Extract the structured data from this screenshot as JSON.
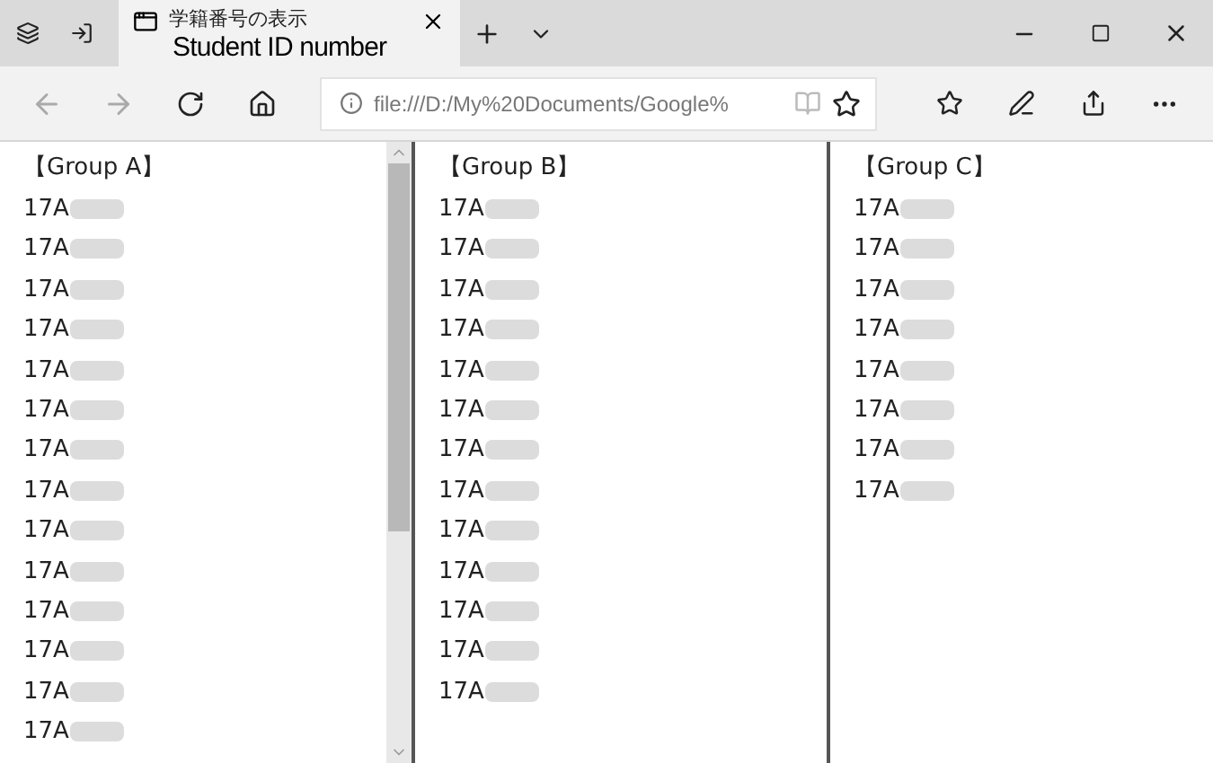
{
  "browser": {
    "tab": {
      "title": "学籍番号の表示",
      "selected": true
    },
    "annotation": "Student ID number",
    "address": "file:///D:/My%20Documents/Google%"
  },
  "frames": [
    {
      "heading": "【Group A】",
      "scrollable": true,
      "items": [
        {
          "text": "17A",
          "redacted": true
        },
        {
          "text": "17A",
          "redacted": true
        },
        {
          "text": "17A",
          "redacted": true
        },
        {
          "text": "17A",
          "redacted": true
        },
        {
          "text": "17A",
          "redacted": true
        },
        {
          "text": "17A",
          "redacted": true
        },
        {
          "text": "17A",
          "redacted": true
        },
        {
          "text": "17A",
          "redacted": true
        },
        {
          "text": "17A",
          "redacted": true
        },
        {
          "text": "17A",
          "redacted": true
        },
        {
          "text": "17A",
          "redacted": true
        },
        {
          "text": "17A",
          "redacted": true
        },
        {
          "text": "17A",
          "redacted": true
        },
        {
          "text": "17A",
          "redacted": true
        }
      ]
    },
    {
      "heading": "【Group B】",
      "scrollable": false,
      "items": [
        {
          "text": "17A",
          "redacted": true
        },
        {
          "text": "17A",
          "redacted": true
        },
        {
          "text": "17A",
          "redacted": true
        },
        {
          "text": "17A",
          "redacted": true
        },
        {
          "text": "17A",
          "redacted": true
        },
        {
          "text": "17A",
          "redacted": true
        },
        {
          "text": "17A",
          "redacted": true
        },
        {
          "text": "17A",
          "redacted": true
        },
        {
          "text": "17A",
          "redacted": true
        },
        {
          "text": "17A",
          "redacted": true
        },
        {
          "text": "17A",
          "redacted": true
        },
        {
          "text": "17A",
          "redacted": true
        },
        {
          "text": "17A",
          "redacted": true
        }
      ]
    },
    {
      "heading": "【Group C】",
      "scrollable": false,
      "items": [
        {
          "text": "17A",
          "redacted": true
        },
        {
          "text": "17A",
          "redacted": true
        },
        {
          "text": "17A",
          "redacted": true
        },
        {
          "text": "17A",
          "redacted": true
        },
        {
          "text": "17A",
          "redacted": true
        },
        {
          "text": "17A",
          "redacted": true
        },
        {
          "text": "17A",
          "redacted": true
        },
        {
          "text": "17A",
          "redacted": true
        }
      ]
    }
  ]
}
